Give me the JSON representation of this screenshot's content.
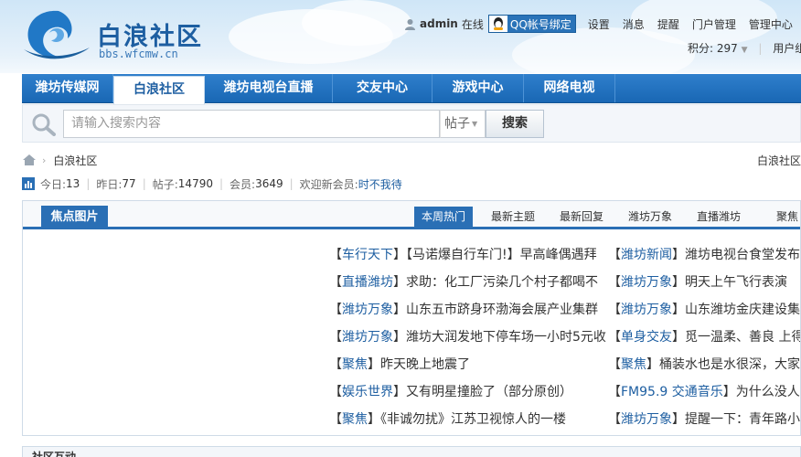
{
  "brand": {
    "title": "白浪社区",
    "url": "bbs.wfcmw.cn"
  },
  "topbar": {
    "username": "admin",
    "online": "在线",
    "qq_bind": "QQ帐号绑定",
    "links": [
      "设置",
      "消息",
      "提醒",
      "门户管理",
      "管理中心"
    ]
  },
  "credits": {
    "label": "积分: 297",
    "usergroup": "用户组"
  },
  "nav": [
    {
      "label": "潍坊传媒网",
      "active": false
    },
    {
      "label": "白浪社区",
      "active": true
    },
    {
      "label": "潍坊电视台直播",
      "active": false
    },
    {
      "label": "交友中心",
      "active": false
    },
    {
      "label": "游戏中心",
      "active": false
    },
    {
      "label": "网络电视",
      "active": false
    }
  ],
  "search": {
    "placeholder": "请输入搜索内容",
    "type": "帖子",
    "button": "搜索"
  },
  "breadcrumb": {
    "current": "白浪社区",
    "right": "白浪社区"
  },
  "stats": {
    "today_label": "今日: ",
    "today": "13",
    "yesterday_label": "昨日: ",
    "yesterday": "77",
    "posts_label": "帖子: ",
    "posts": "14790",
    "members_label": "会员: ",
    "members": "3649",
    "welcome": "欢迎新会员: ",
    "new_member": "时不我待"
  },
  "panel": {
    "focus_tab": "焦点图片",
    "tabs": [
      {
        "label": "本周热门",
        "active": true
      },
      {
        "label": "最新主题",
        "active": false
      },
      {
        "label": "最新回复",
        "active": false
      },
      {
        "label": "潍坊万象",
        "active": false
      },
      {
        "label": "直播潍坊",
        "active": false
      },
      {
        "label": "聚焦",
        "active": false
      }
    ],
    "news_left": [
      {
        "cat": "车行天下",
        "title": "【马诺爆自行车门!】早高峰偶遇拜"
      },
      {
        "cat": "直播潍坊",
        "title": "求助：化工厂污染几个村子都喝不"
      },
      {
        "cat": "潍坊万象",
        "title": "山东五市跻身环渤海会展产业集群"
      },
      {
        "cat": "潍坊万象",
        "title": "潍坊大润发地下停车场一小时5元收"
      },
      {
        "cat": "聚焦",
        "title": "昨天晚上地震了"
      },
      {
        "cat": "娱乐世界",
        "title": "又有明星撞脸了（部分原创）"
      },
      {
        "cat": "聚焦",
        "title": "《非诚勿扰》江苏卫视惊人的一楼"
      }
    ],
    "news_right": [
      {
        "cat": "潍坊新闻",
        "title": "潍坊电视台食堂发布"
      },
      {
        "cat": "潍坊万象",
        "title": "明天上午飞行表演"
      },
      {
        "cat": "潍坊万象",
        "title": "山东潍坊金庆建设集团"
      },
      {
        "cat": "单身交友",
        "title": "觅一温柔、善良 上得"
      },
      {
        "cat": "聚焦",
        "title": "桶装水也是水很深，大家"
      },
      {
        "cat": "FM95.9 交通音乐",
        "title": "为什么没人关"
      },
      {
        "cat": "潍坊万象",
        "title": "提醒一下：青年路小"
      }
    ]
  },
  "bottom": {
    "label": "社区互动"
  }
}
